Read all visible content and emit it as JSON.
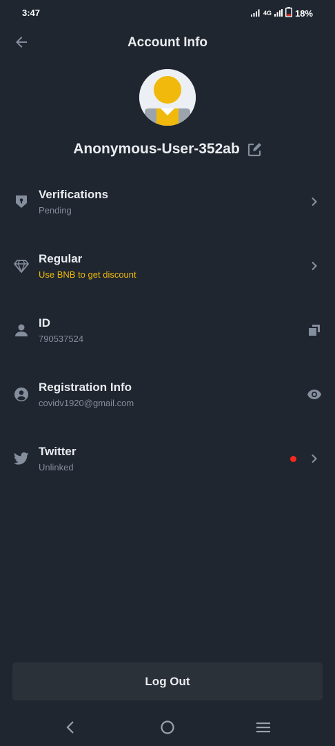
{
  "status_bar": {
    "time": "3:47",
    "network": "4G",
    "battery": "18%"
  },
  "header": {
    "title": "Account Info",
    "back_icon": "arrow-left-icon"
  },
  "profile": {
    "name": "Anonymous-User-352ab",
    "edit_icon": "edit-icon"
  },
  "rows": [
    {
      "title": "Verifications",
      "subtitle": "Pending",
      "left_icon": "shield-icon",
      "right_icon": "chevron-right-icon"
    },
    {
      "title": "Regular",
      "subtitle": "Use BNB to get discount",
      "left_icon": "diamond-icon",
      "right_icon": "chevron-right-icon"
    },
    {
      "title": "ID",
      "subtitle": "790537524",
      "left_icon": "person-icon",
      "right_icon": "copy-icon"
    },
    {
      "title": "Registration Info",
      "subtitle": "covidv1920@gmail.com",
      "left_icon": "account-circle-icon",
      "right_icon": "eye-icon"
    },
    {
      "title": "Twitter",
      "subtitle": "Unlinked",
      "left_icon": "twitter-icon",
      "right_icon": "chevron-right-icon"
    }
  ],
  "logout": {
    "label": "Log Out"
  },
  "colors": {
    "background": "#1f2630",
    "accent": "#f0b90b",
    "text_primary": "#eaecef",
    "text_secondary": "#848e9c",
    "button_bg": "#2b3139",
    "alert_dot": "#f6291c"
  }
}
